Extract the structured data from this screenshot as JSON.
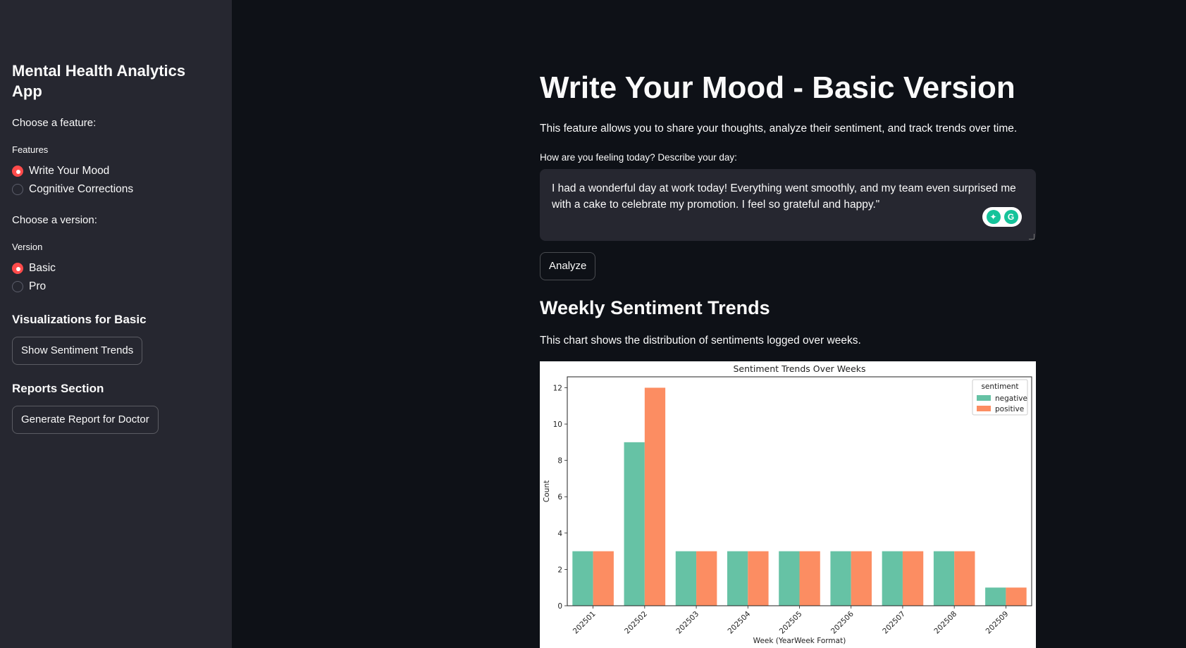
{
  "sidebar": {
    "title": "Mental Health Analytics App",
    "feature_prompt": "Choose a feature:",
    "features_label": "Features",
    "features": [
      {
        "label": "Write Your Mood",
        "selected": true
      },
      {
        "label": "Cognitive Corrections",
        "selected": false
      }
    ],
    "version_prompt": "Choose a version:",
    "version_label": "Version",
    "versions": [
      {
        "label": "Basic",
        "selected": true
      },
      {
        "label": "Pro",
        "selected": false
      }
    ],
    "viz_heading": "Visualizations for Basic",
    "show_trends_button": "Show Sentiment Trends",
    "reports_heading": "Reports Section",
    "report_button": "Generate Report for Doctor"
  },
  "main": {
    "title": "Write Your Mood - Basic Version",
    "intro": "This feature allows you to share your thoughts, analyze their sentiment, and track trends over time.",
    "textarea_label": "How are you feeling today? Describe your day:",
    "textarea_value": "I had a wonderful day at work today! Everything went smoothly, and my team even surprised me with a cake to celebrate my promotion. I feel so grateful and happy.\"",
    "analyze_button": "Analyze",
    "section_title": "Weekly Sentiment Trends",
    "section_desc": "This chart shows the distribution of sentiments logged over weeks."
  },
  "icons": {
    "grammarly_left": "lightbulb-icon",
    "grammarly_right": "grammarly-g-icon"
  },
  "colors": {
    "accent": "#ff4b4b",
    "negative": "#66c2a5",
    "positive": "#fc8d62"
  },
  "chart_data": {
    "type": "bar",
    "title": "Sentiment Trends Over Weeks",
    "xlabel": "Week (YearWeek Format)",
    "ylabel": "Count",
    "categories": [
      "202501",
      "202502",
      "202503",
      "202504",
      "202505",
      "202506",
      "202507",
      "202508",
      "202509"
    ],
    "series": [
      {
        "name": "negative",
        "values": [
          3,
          9,
          3,
          3,
          3,
          3,
          3,
          3,
          1
        ],
        "color": "#66c2a5"
      },
      {
        "name": "positive",
        "values": [
          3,
          12,
          3,
          3,
          3,
          3,
          3,
          3,
          1
        ],
        "color": "#fc8d62"
      }
    ],
    "legend_title": "sentiment",
    "legend_position": "top-right",
    "ylim": [
      0,
      12.6
    ],
    "yticks": [
      0,
      2,
      4,
      6,
      8,
      10,
      12
    ],
    "grid": false
  }
}
